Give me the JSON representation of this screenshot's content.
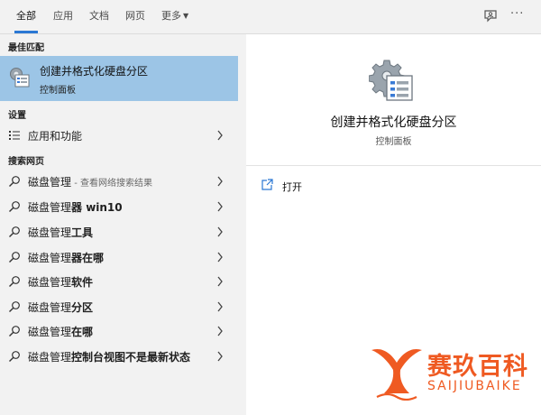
{
  "tabs": [
    {
      "label": "全部",
      "active": true
    },
    {
      "label": "应用",
      "active": false
    },
    {
      "label": "文档",
      "active": false
    },
    {
      "label": "网页",
      "active": false
    },
    {
      "label": "更多",
      "active": false,
      "caret": "▼"
    }
  ],
  "toolbar": {
    "feedback_icon": "feedback-person-icon",
    "more_label": "···"
  },
  "sections": {
    "best_match": "最佳匹配",
    "settings": "设置",
    "web": "搜索网页"
  },
  "best_match": {
    "title": "创建并格式化硬盘分区",
    "subtitle": "控制面板",
    "icon": "disk-management-icon"
  },
  "settings_item": {
    "label": "应用和功能",
    "icon": "list-icon"
  },
  "web_results": [
    {
      "base": "磁盘管理",
      "bold": "",
      "hint": " - 查看网络搜索结果"
    },
    {
      "base": "磁盘管理",
      "bold": "器 win10",
      "hint": ""
    },
    {
      "base": "磁盘管理",
      "bold": "工具",
      "hint": ""
    },
    {
      "base": "磁盘管理",
      "bold": "器在哪",
      "hint": ""
    },
    {
      "base": "磁盘管理",
      "bold": "软件",
      "hint": ""
    },
    {
      "base": "磁盘管理",
      "bold": "分区",
      "hint": ""
    },
    {
      "base": "磁盘管理",
      "bold": "在哪",
      "hint": ""
    },
    {
      "base": "磁盘管理",
      "bold": "控制台视图不是最新状态",
      "hint": ""
    }
  ],
  "preview": {
    "title": "创建并格式化硬盘分区",
    "subtitle": "控制面板",
    "actions": [
      {
        "label": "打开",
        "icon": "open-icon"
      }
    ]
  },
  "watermark": {
    "name": "赛玖百科",
    "pinyin": "SAIJIUBAIKE"
  },
  "colors": {
    "accent": "#2b78d4",
    "selected_bg": "#9cc5e6",
    "panel_bg": "#f2f2f2",
    "watermark": "#ef5a22"
  }
}
